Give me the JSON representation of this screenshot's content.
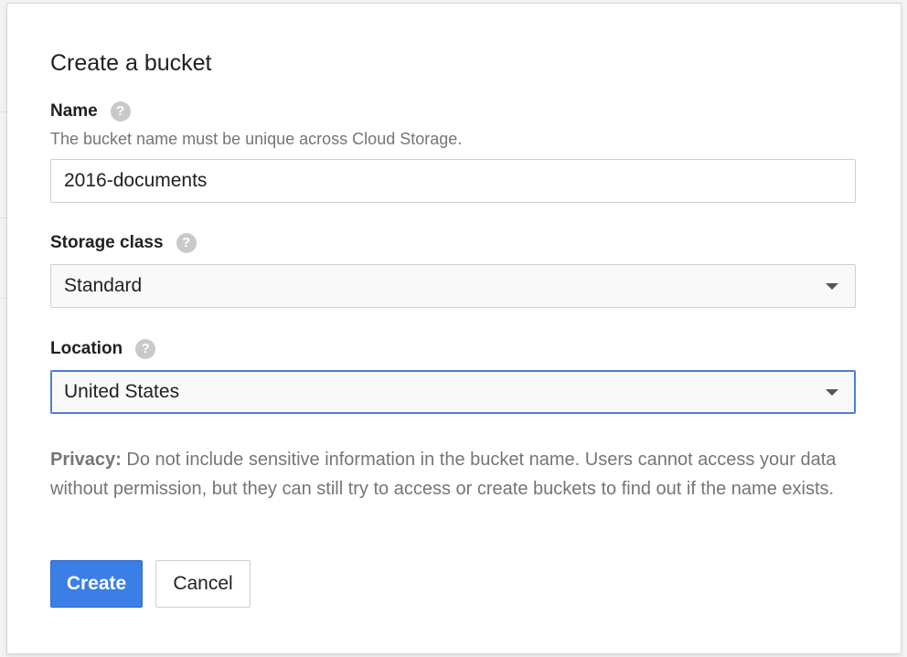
{
  "dialog": {
    "title": "Create a bucket"
  },
  "name_field": {
    "label": "Name",
    "help_icon": "?",
    "hint": "The bucket name must be unique across Cloud Storage.",
    "value": "2016-documents"
  },
  "storage_class": {
    "label": "Storage class",
    "help_icon": "?",
    "selected": "Standard"
  },
  "location": {
    "label": "Location",
    "help_icon": "?",
    "selected": "United States"
  },
  "privacy": {
    "heading": "Privacy:",
    "text": " Do not include sensitive information in the bucket name. Users cannot access your data without permission, but they can still try to access or create buckets to find out if the name exists."
  },
  "buttons": {
    "create": "Create",
    "cancel": "Cancel"
  },
  "colors": {
    "primary_button": "#3b7ee6",
    "focus_border": "#4a7fd4",
    "help_icon": "#c9c9c9"
  },
  "icons": {
    "help": "help-circle-icon",
    "dropdown": "caret-down-icon"
  }
}
